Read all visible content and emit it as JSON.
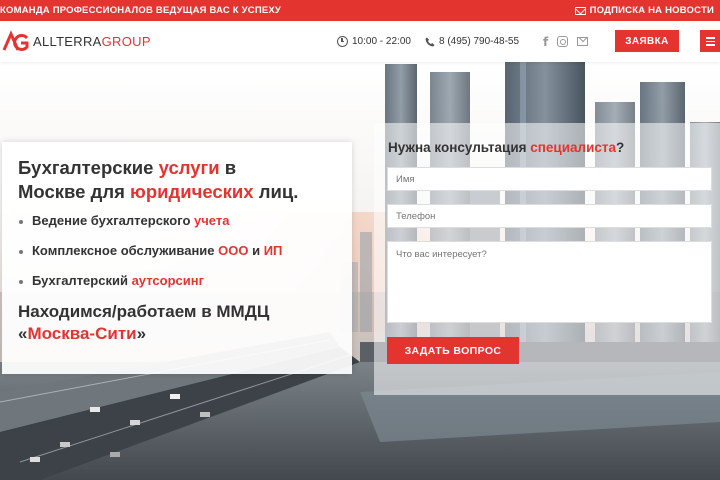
{
  "topbar": {
    "tagline": "КОМАНДА ПРОФЕССИОНАЛОВ ВЕДУЩАЯ ВАС К УСПЕХУ",
    "subscribe": "ПОДПИСКА НА НОВОСТИ"
  },
  "header": {
    "logo_part1": "ALLTERRA",
    "logo_part2": "GROUP",
    "hours": "10:00 - 22:00",
    "phone": "8 (495) 790-48-55",
    "cta": "ЗАЯВКА"
  },
  "hero": {
    "title_1": "Бухгалтерские ",
    "title_2": "услуги",
    "title_3": " в",
    "title_4": "Москве для ",
    "title_5": "юридических",
    "title_6": " лиц.",
    "items": [
      {
        "a": "Ведение бухгалтерского ",
        "b": "учета",
        "c": "",
        "d": ""
      },
      {
        "a": "Комплексное обслуживание ",
        "b": "ООО",
        "c": " и ",
        "d": "ИП"
      },
      {
        "a": "Бухгалтерский ",
        "b": "аутсорсинг",
        "c": "",
        "d": ""
      }
    ],
    "sub_1": "Находимся/работаем в ММДЦ",
    "sub_2": "«",
    "sub_3": "Москва-Сити",
    "sub_4": "»"
  },
  "form": {
    "title_1": "Нужна консультация ",
    "title_2": "специалиста",
    "title_3": "?",
    "name_placeholder": "Имя",
    "phone_placeholder": "Телефон",
    "message_placeholder": "Что вас интересует?",
    "submit": "ЗАДАТЬ ВОПРОС"
  },
  "colors": {
    "accent": "#e3342f",
    "text": "#333333"
  }
}
